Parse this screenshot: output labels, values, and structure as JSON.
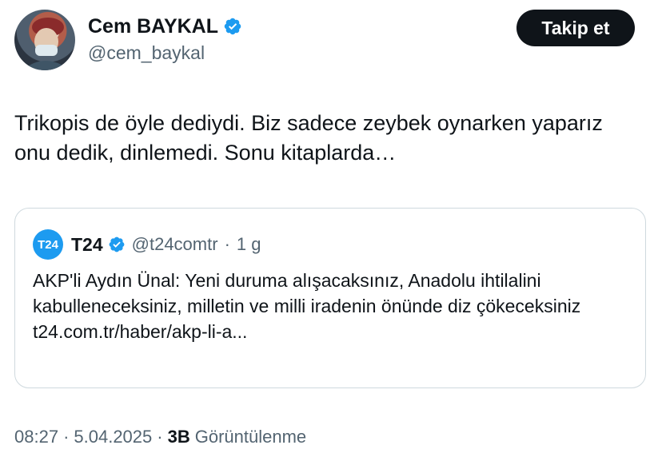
{
  "author": {
    "display_name": "Cem BAYKAL",
    "handle": "@cem_baykal",
    "verified_icon": "verified-badge-icon"
  },
  "follow_button": {
    "label": "Takip et"
  },
  "tweet": {
    "text": "Trikopis de öyle dediydi. Biz sadece zeybek oynarken yaparız onu dedik, dinlemedi. Sonu kitaplarda…"
  },
  "quote": {
    "avatar_text": "T24",
    "display_name": "T24",
    "handle": "@t24comtr",
    "separator": "·",
    "time": "1 g",
    "text": "AKP'li Aydın Ünal: Yeni duruma alışacaksınız, Anadolu ihtilalini kabulleneceksiniz, milletin ve milli iradenin önünde diz çökeceksiniz",
    "link": "t24.com.tr/haber/akp-li-a..."
  },
  "footer": {
    "time": "08:27",
    "separator": "·",
    "date": "5.04.2025",
    "views_count": "3B",
    "views_label": "Görüntülenme"
  },
  "colors": {
    "text": "#0f1419",
    "secondary": "#536471",
    "verified": "#1d9bf0",
    "border": "#cfd9de",
    "button_bg": "#0f1419"
  }
}
